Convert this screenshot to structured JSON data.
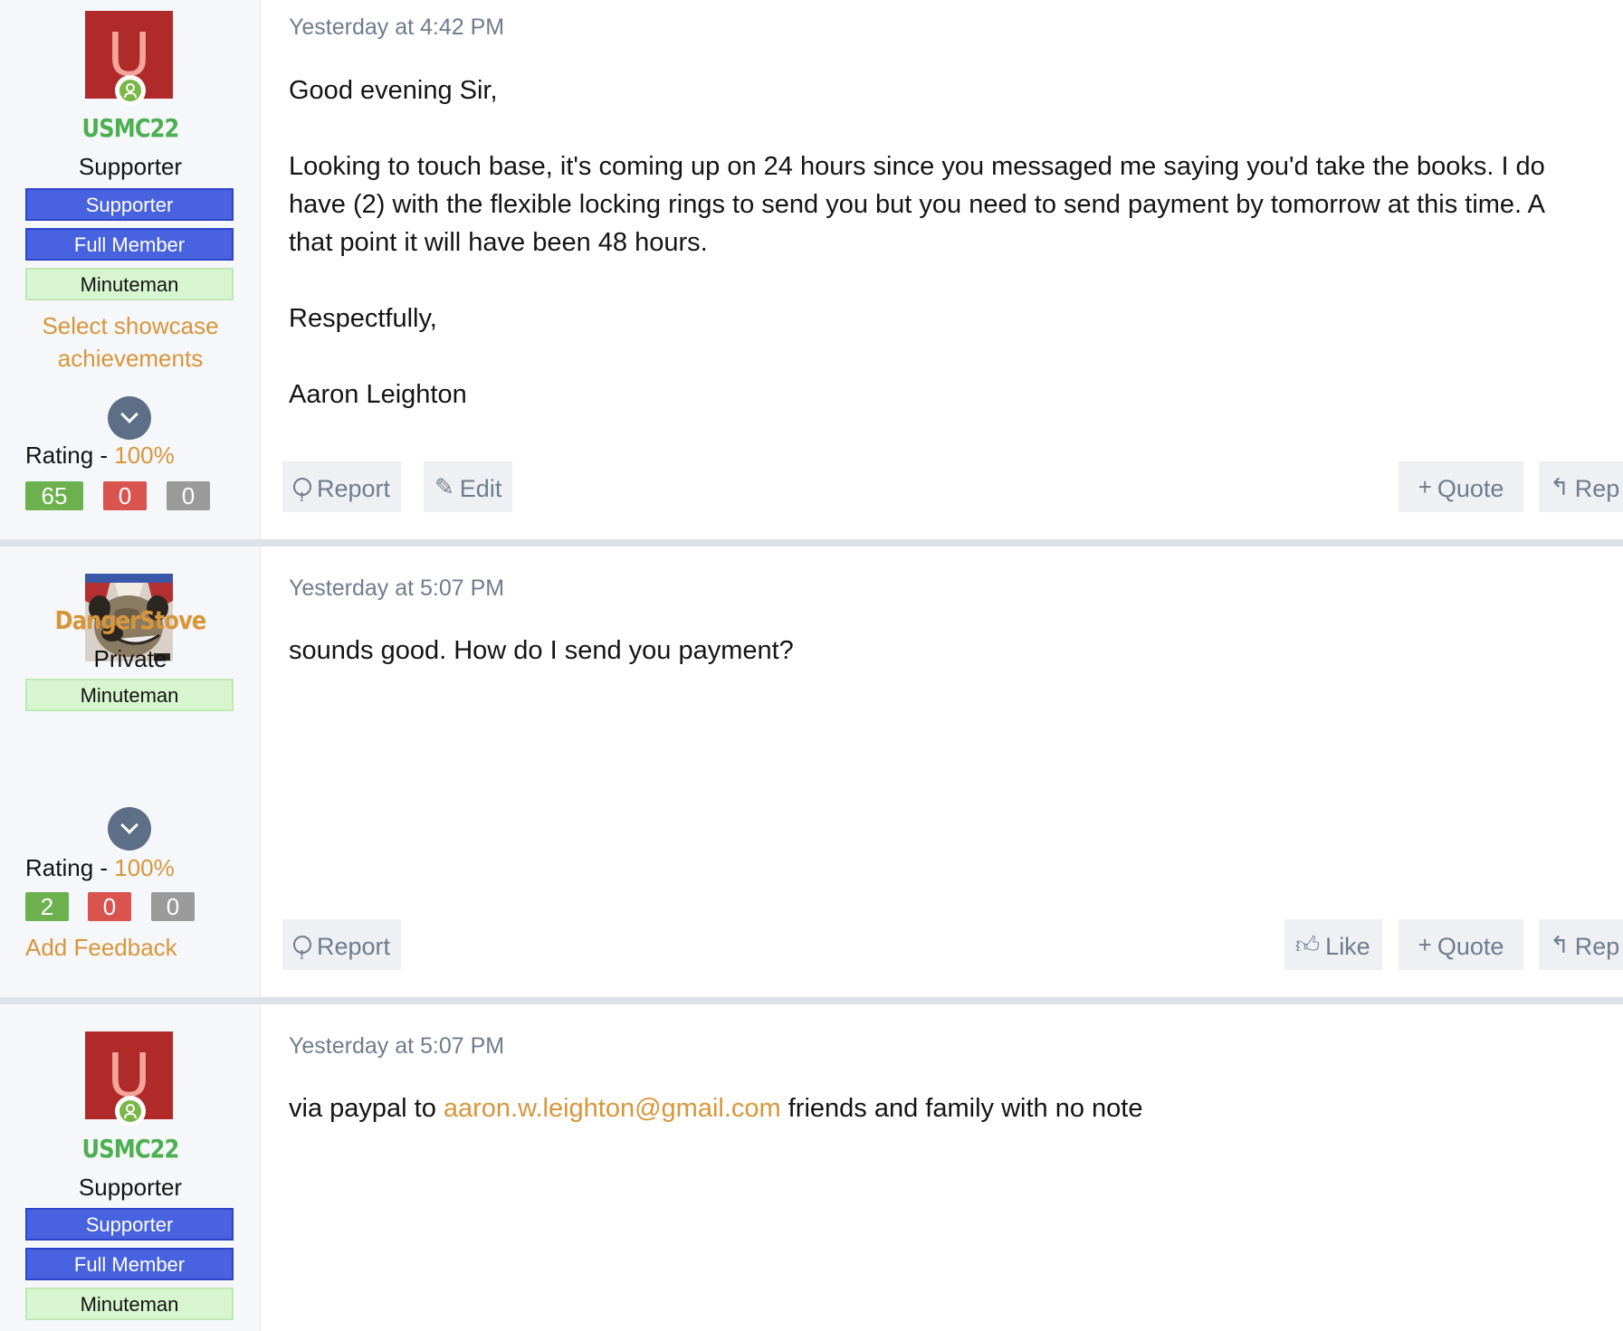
{
  "posts": [
    {
      "user": {
        "avatar_letter": "U",
        "username": "USMC22",
        "title": "Supporter",
        "banners": [
          "Supporter",
          "Full Member",
          "Minuteman"
        ],
        "showcase_line1": "Select showcase",
        "showcase_line2": "achievements",
        "rating_label": "Rating - ",
        "rating_value": "100%",
        "feedback": [
          "65",
          "0",
          "0"
        ]
      },
      "date": "Yesterday at 4:42 PM",
      "body": {
        "line1": "Good evening Sir,",
        "line2": "Looking to touch base, it's coming up on 24 hours since you messaged me saying you'd take the books. I do",
        "line3": "have (2) with the flexible locking rings to send you but you need to send payment by tomorrow at this time. A",
        "line4": "that point it will have been 48 hours.",
        "line5": "Respectfully,",
        "line6": "Aaron Leighton"
      },
      "actions": {
        "report": "Report",
        "edit": "Edit",
        "quote": "Quote",
        "reply": "Rep"
      }
    },
    {
      "user": {
        "username": "DangerStove",
        "title": "Private",
        "banners": [
          "Minuteman"
        ],
        "rating_label": "Rating - ",
        "rating_value": "100%",
        "feedback": [
          "2",
          "0",
          "0"
        ],
        "add_feedback": "Add Feedback"
      },
      "date": "Yesterday at 5:07 PM",
      "body": {
        "line1": "sounds good. How do I send you payment?"
      },
      "actions": {
        "report": "Report",
        "like": "Like",
        "quote": "Quote",
        "reply": "Rep"
      }
    },
    {
      "user": {
        "avatar_letter": "U",
        "username": "USMC22",
        "title": "Supporter",
        "banners": [
          "Supporter",
          "Full Member",
          "Minuteman"
        ]
      },
      "date": "Yesterday at 5:07 PM",
      "body": {
        "prefix": "via paypal to ",
        "email": "aaron.w.leighton@gmail.com",
        "suffix": " friends and family with no note"
      }
    }
  ],
  "icons": {
    "report": "report-icon",
    "edit": "pencil-icon",
    "quote": "plus-icon",
    "reply": "reply-icon",
    "like": "thumbs-up-icon",
    "expand": "chevron-down-icon",
    "online": "online-status-icon"
  },
  "colors": {
    "accent": "#d8963a",
    "username_green": "#4caf50",
    "banner_blue": "#4862e0",
    "banner_green": "#d7f5cf",
    "positive": "#6db14f",
    "negative": "#d9534f",
    "neutral": "#9a9a9a"
  }
}
